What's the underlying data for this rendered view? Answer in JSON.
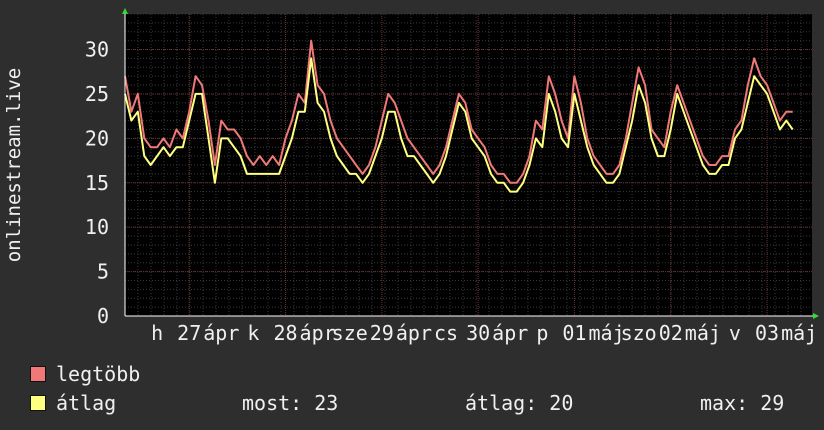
{
  "chart_data": {
    "type": "line",
    "ylabel": "onlinestream.live",
    "ylim": [
      0,
      34
    ],
    "yticks": [
      0,
      5,
      10,
      15,
      20,
      25,
      30
    ],
    "grid": true,
    "x_tick_labels": [
      "h",
      "27",
      "ápr",
      "k",
      "28",
      "ápr",
      "sze",
      "29",
      "ápr",
      "cs",
      "30",
      "ápr",
      "p",
      "01",
      "máj",
      "szo",
      "02",
      "máj",
      "v",
      "03",
      "máj"
    ],
    "x_tick_positions": [
      0.25,
      0.5,
      0.75,
      1.0,
      1.25,
      1.5,
      1.75,
      2.0,
      2.25,
      2.5,
      2.75,
      3.0,
      3.25,
      3.5,
      3.75,
      4.0,
      4.25,
      4.5,
      4.75,
      5.0,
      5.25
    ],
    "x_range": [
      0,
      5.35
    ],
    "series": [
      {
        "name": "legtöbb",
        "color": "#f07878",
        "x": [
          0.0,
          0.05,
          0.1,
          0.15,
          0.2,
          0.25,
          0.3,
          0.35,
          0.4,
          0.45,
          0.5,
          0.55,
          0.6,
          0.65,
          0.7,
          0.75,
          0.8,
          0.85,
          0.9,
          0.95,
          1.0,
          1.05,
          1.1,
          1.15,
          1.2,
          1.25,
          1.3,
          1.35,
          1.4,
          1.45,
          1.5,
          1.55,
          1.6,
          1.65,
          1.7,
          1.75,
          1.8,
          1.85,
          1.9,
          1.95,
          2.0,
          2.05,
          2.1,
          2.15,
          2.2,
          2.25,
          2.3,
          2.35,
          2.4,
          2.45,
          2.5,
          2.55,
          2.6,
          2.65,
          2.7,
          2.75,
          2.8,
          2.85,
          2.9,
          2.95,
          3.0,
          3.05,
          3.1,
          3.15,
          3.2,
          3.25,
          3.3,
          3.35,
          3.4,
          3.45,
          3.5,
          3.55,
          3.6,
          3.65,
          3.7,
          3.75,
          3.8,
          3.85,
          3.9,
          3.95,
          4.0,
          4.05,
          4.1,
          4.15,
          4.2,
          4.25,
          4.3,
          4.35,
          4.4,
          4.45,
          4.5,
          4.55,
          4.6,
          4.65,
          4.7,
          4.75,
          4.8,
          4.85,
          4.9,
          4.95,
          5.0,
          5.05,
          5.1,
          5.15,
          5.2
        ],
        "values": [
          27,
          23,
          25,
          20,
          19,
          19,
          20,
          19,
          21,
          20,
          23,
          27,
          26,
          22,
          17,
          22,
          21,
          21,
          20,
          18,
          17,
          18,
          17,
          18,
          17,
          20,
          22,
          25,
          24,
          31,
          26,
          25,
          22,
          20,
          19,
          18,
          17,
          16,
          17,
          19,
          22,
          25,
          24,
          22,
          20,
          19,
          18,
          17,
          16,
          17,
          19,
          22,
          25,
          24,
          21,
          20,
          19,
          17,
          16,
          16,
          15,
          15,
          16,
          18,
          22,
          21,
          27,
          25,
          22,
          20,
          27,
          24,
          20,
          18,
          17,
          16,
          16,
          17,
          20,
          24,
          28,
          26,
          21,
          20,
          19,
          23,
          26,
          24,
          22,
          20,
          18,
          17,
          17,
          18,
          18,
          21,
          22,
          26,
          29,
          27,
          26,
          24,
          22,
          23,
          23
        ]
      },
      {
        "name": "átlag",
        "color": "#ffff80",
        "x": [
          0.0,
          0.05,
          0.1,
          0.15,
          0.2,
          0.25,
          0.3,
          0.35,
          0.4,
          0.45,
          0.5,
          0.55,
          0.6,
          0.65,
          0.7,
          0.75,
          0.8,
          0.85,
          0.9,
          0.95,
          1.0,
          1.05,
          1.1,
          1.15,
          1.2,
          1.25,
          1.3,
          1.35,
          1.4,
          1.45,
          1.5,
          1.55,
          1.6,
          1.65,
          1.7,
          1.75,
          1.8,
          1.85,
          1.9,
          1.95,
          2.0,
          2.05,
          2.1,
          2.15,
          2.2,
          2.25,
          2.3,
          2.35,
          2.4,
          2.45,
          2.5,
          2.55,
          2.6,
          2.65,
          2.7,
          2.75,
          2.8,
          2.85,
          2.9,
          2.95,
          3.0,
          3.05,
          3.1,
          3.15,
          3.2,
          3.25,
          3.3,
          3.35,
          3.4,
          3.45,
          3.5,
          3.55,
          3.6,
          3.65,
          3.7,
          3.75,
          3.8,
          3.85,
          3.9,
          3.95,
          4.0,
          4.05,
          4.1,
          4.15,
          4.2,
          4.25,
          4.3,
          4.35,
          4.4,
          4.45,
          4.5,
          4.55,
          4.6,
          4.65,
          4.7,
          4.75,
          4.8,
          4.85,
          4.9,
          4.95,
          5.0,
          5.05,
          5.1,
          5.15,
          5.2
        ],
        "values": [
          25,
          22,
          23,
          18,
          17,
          18,
          19,
          18,
          19,
          19,
          22,
          25,
          25,
          20,
          15,
          20,
          20,
          19,
          18,
          16,
          16,
          16,
          16,
          16,
          16,
          18,
          20,
          23,
          23,
          29,
          24,
          23,
          20,
          18,
          17,
          16,
          16,
          15,
          16,
          18,
          20,
          23,
          23,
          20,
          18,
          18,
          17,
          16,
          15,
          16,
          18,
          21,
          24,
          23,
          20,
          19,
          18,
          16,
          15,
          15,
          14,
          14,
          15,
          17,
          20,
          19,
          25,
          23,
          20,
          19,
          25,
          22,
          19,
          17,
          16,
          15,
          15,
          16,
          19,
          22,
          26,
          24,
          20,
          18,
          18,
          21,
          25,
          23,
          21,
          19,
          17,
          16,
          16,
          17,
          17,
          20,
          21,
          24,
          27,
          26,
          25,
          23,
          21,
          22,
          21
        ]
      }
    ]
  },
  "legend": {
    "items": [
      {
        "label": "legtöbb",
        "color": "#f07878"
      },
      {
        "label": "átlag",
        "color": "#ffff80"
      }
    ]
  },
  "stats": {
    "most": "most: 23",
    "atlag": "átlag: 20",
    "max": "max: 29"
  }
}
